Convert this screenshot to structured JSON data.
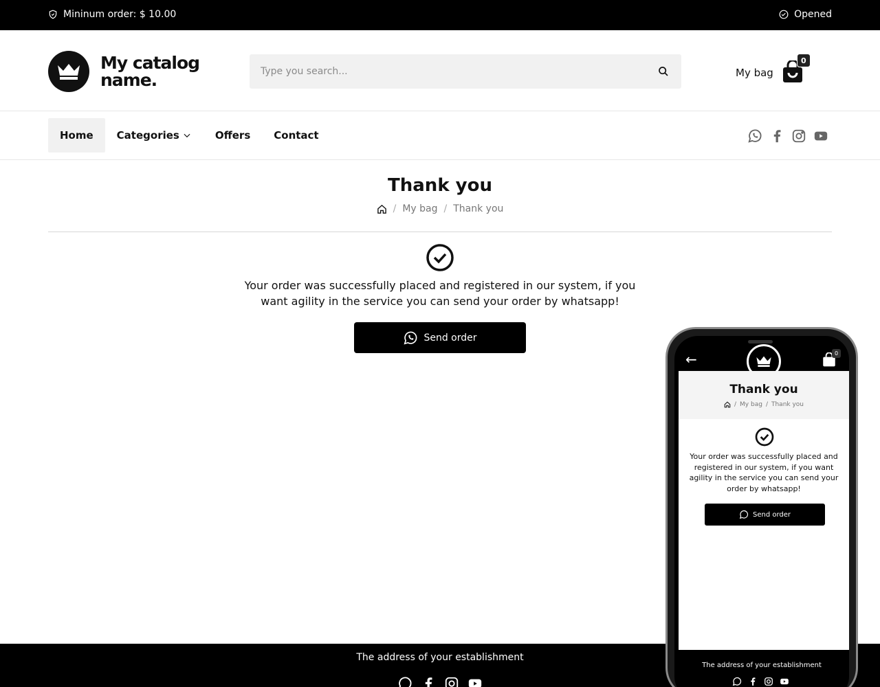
{
  "topbar": {
    "minimum_order": "Mininum order: $ 10.00",
    "status": "Opened"
  },
  "header": {
    "logo_text": "My catalog name.",
    "search_placeholder": "Type you search...",
    "bag_label": "My bag",
    "bag_count": "0"
  },
  "nav": {
    "items": [
      {
        "label": "Home",
        "active": true
      },
      {
        "label": "Categories",
        "has_dropdown": true
      },
      {
        "label": "Offers"
      },
      {
        "label": "Contact"
      }
    ],
    "social": [
      "whatsapp-icon",
      "facebook-icon",
      "instagram-icon",
      "youtube-icon"
    ]
  },
  "page": {
    "title": "Thank you",
    "breadcrumb": [
      "My bag",
      "Thank you"
    ],
    "message": "Your order was successfully placed and registered in our system, if you want agility in the service you can send your order by whatsapp!",
    "button_label": "Send order"
  },
  "footer": {
    "address": "The address of your establishment"
  },
  "phone": {
    "title": "Thank you",
    "breadcrumb": [
      "My bag",
      "Thank you"
    ],
    "bag_count": "0",
    "message": "Your order was successfully placed and registered in our system, if you want agility in the service you can send your order by whatsapp!",
    "button_label": "Send order",
    "address": "The address of your establishment"
  },
  "colors": {
    "primary": "#000000",
    "background": "#ffffff",
    "muted_bg": "#f1f1f1"
  }
}
